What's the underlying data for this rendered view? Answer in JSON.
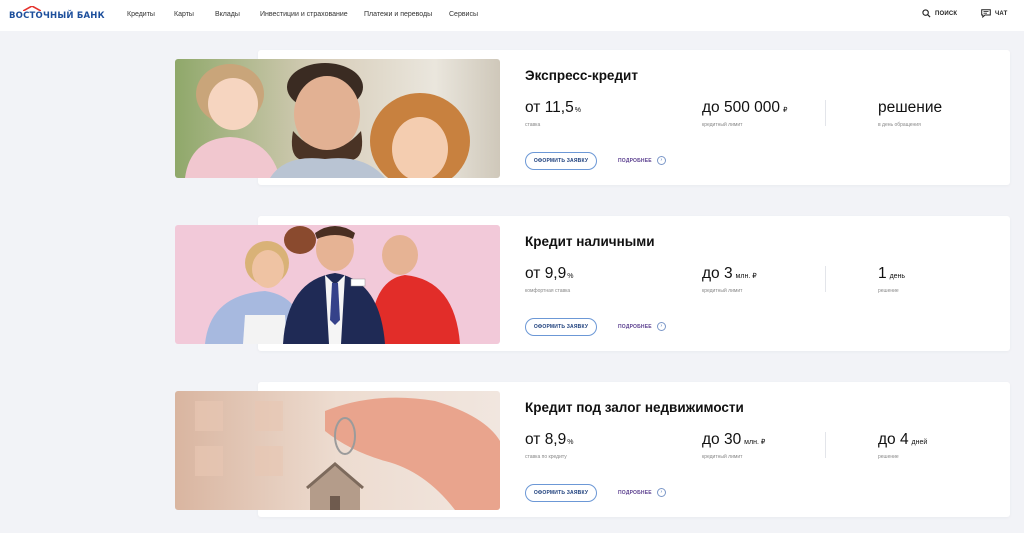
{
  "header": {
    "logo": "ВОСТОЧНЫЙ БАНК",
    "nav": [
      "Кредиты",
      "Карты",
      "Вклады",
      "Инвестиции и страхование",
      "Платежи и переводы",
      "Сервисы"
    ],
    "search_label": "поиск",
    "chat_label": "чат"
  },
  "products": [
    {
      "title": "Экспресс-кредит",
      "stat1": {
        "prefix": "от ",
        "value": "11,5",
        "unit": "%",
        "caption": "ставка"
      },
      "stat2": {
        "prefix": "до ",
        "value": "500 000",
        "unit": " ₽",
        "caption": "кредитный лимит"
      },
      "stat3": {
        "prefix": "",
        "value": "решение",
        "unit": "",
        "caption": "в день обращения"
      },
      "apply_label": "оформить заявку",
      "more_label": "подробнее"
    },
    {
      "title": "Кредит наличными",
      "stat1": {
        "prefix": "от ",
        "value": "9,9",
        "unit": "%",
        "caption": "комфортная ставка"
      },
      "stat2": {
        "prefix": "до ",
        "value": "3",
        "unit": " млн. ₽",
        "caption": "кредитный лимит"
      },
      "stat3": {
        "prefix": "",
        "value": "1",
        "unit": " день",
        "caption": "решение"
      },
      "apply_label": "оформить заявку",
      "more_label": "подробнее"
    },
    {
      "title": "Кредит под залог недвижимости",
      "stat1": {
        "prefix": "от ",
        "value": "8,9",
        "unit": "%",
        "caption": "ставка по кредиту"
      },
      "stat2": {
        "prefix": "до ",
        "value": "30",
        "unit": " млн. ₽",
        "caption": "кредитный лимит"
      },
      "stat3": {
        "prefix": "до ",
        "value": "4",
        "unit": " дней",
        "caption": "решение"
      },
      "apply_label": "оформить заявку",
      "more_label": "подробнее"
    }
  ],
  "colors": {
    "brand": "#1d4f9c",
    "accent_red": "#e5322d",
    "background": "#f2f3f7"
  }
}
